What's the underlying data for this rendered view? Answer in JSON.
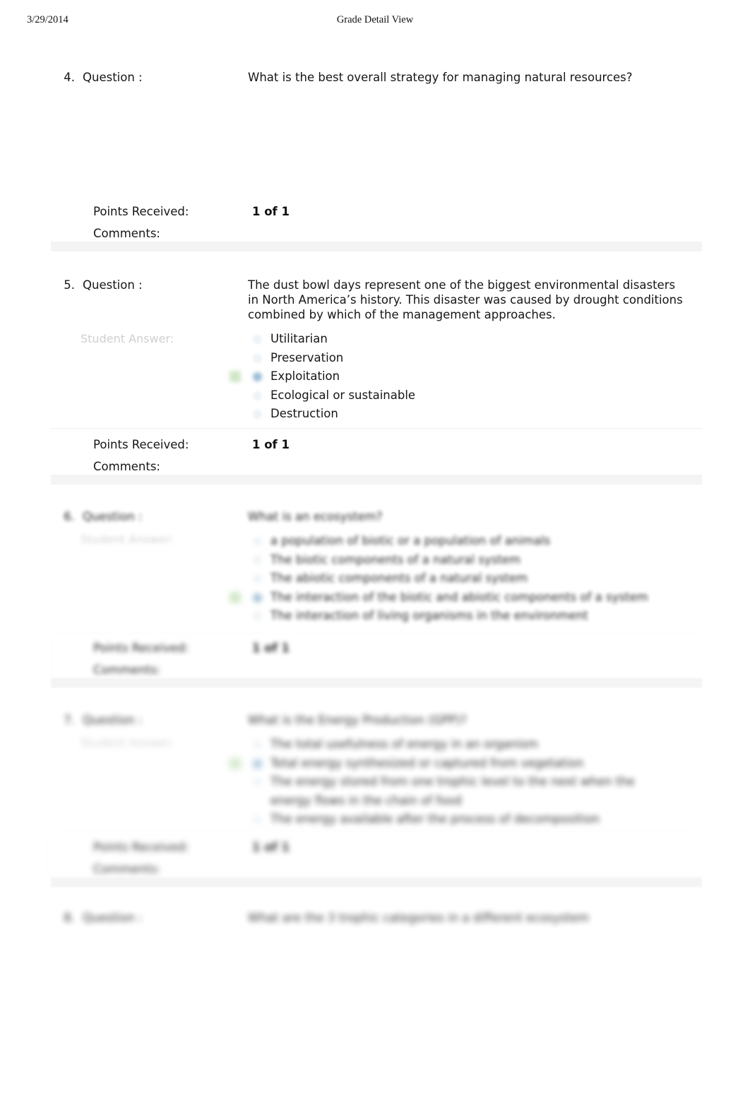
{
  "page": {
    "header_date": "3/29/2014",
    "header_title": "Grade Detail View"
  },
  "labels": {
    "question_label": "Question :",
    "student_answer_label": "Student Answer:",
    "points_received_label": "Points Received:",
    "comments_label": "Comments:"
  },
  "colors": {
    "page_background": "#ffffff",
    "text": "#161616",
    "muted_label": "#cfcfcf",
    "panel_background": "#ffffff",
    "separator_band": "#f4f4f4",
    "correct_marker_green": "#cfe6c6",
    "selected_radio_blue": "#9dbdd6"
  },
  "questions": [
    {
      "number": "4.",
      "question_label": "Question :",
      "text": "What is the best overall strategy for managing natural resources?",
      "student_answer_label": "",
      "options": [],
      "points_label": "Points Received:",
      "points_value": "1 of 1",
      "comments_label": "Comments:",
      "comments_value": "",
      "legible": true
    },
    {
      "number": "5.",
      "question_label": "Question :",
      "text": "The dust bowl days represent one of the biggest environmental disasters in North America’s history. This disaster was caused by drought conditions combined by which of the management approaches.",
      "student_answer_label": "Student Answer:",
      "options": [
        {
          "text": "Utilitarian",
          "selected": false,
          "correct": false
        },
        {
          "text": "Preservation",
          "selected": false,
          "correct": false
        },
        {
          "text": "Exploitation",
          "selected": true,
          "correct": true
        },
        {
          "text": "Ecological or sustainable",
          "selected": false,
          "correct": false
        },
        {
          "text": "Destruction",
          "selected": false,
          "correct": false
        }
      ],
      "points_label": "Points Received:",
      "points_value": "1 of 1",
      "comments_label": "Comments:",
      "comments_value": "",
      "legible": true
    },
    {
      "number": "6.",
      "question_label": "Question :",
      "text": "What is an ecosystem?",
      "student_answer_label": "Student Answer:",
      "options": [
        {
          "text": "a population of biotic or a population of animals",
          "selected": false,
          "correct": false
        },
        {
          "text": "The biotic components of a natural system",
          "selected": false,
          "correct": false
        },
        {
          "text": "The abiotic components of a natural system",
          "selected": false,
          "correct": false
        },
        {
          "text": "The interaction of the biotic and abiotic components of a system",
          "selected": true,
          "correct": true
        },
        {
          "text": "The interaction of living organisms in the environment",
          "selected": false,
          "correct": false
        }
      ],
      "points_label": "Points Received:",
      "points_value": "1 of 1",
      "comments_label": "Comments:",
      "comments_value": "",
      "legible": false
    },
    {
      "number": "7.",
      "question_label": "Question :",
      "text": "What is the Energy Production (GPP)?",
      "student_answer_label": "Student Answer:",
      "options": [
        {
          "text": "The total usefulness of energy in an organism",
          "selected": false,
          "correct": false
        },
        {
          "text": "Total energy synthesized or captured from vegetation",
          "selected": true,
          "correct": true
        },
        {
          "text": "The energy stored from one trophic level to the next when the energy flows in the chain of food",
          "selected": false,
          "correct": false
        },
        {
          "text": "The energy available after the process of decomposition",
          "selected": false,
          "correct": false
        }
      ],
      "points_label": "Points Received:",
      "points_value": "1 of 1",
      "comments_label": "Comments:",
      "comments_value": "",
      "legible": false
    },
    {
      "number": "8.",
      "question_label": "Question :",
      "text": "What are the 3 trophic categories in a different ecosystem",
      "student_answer_label": "",
      "options": [],
      "points_label": "",
      "points_value": "",
      "comments_label": "",
      "comments_value": "",
      "legible": false
    }
  ]
}
